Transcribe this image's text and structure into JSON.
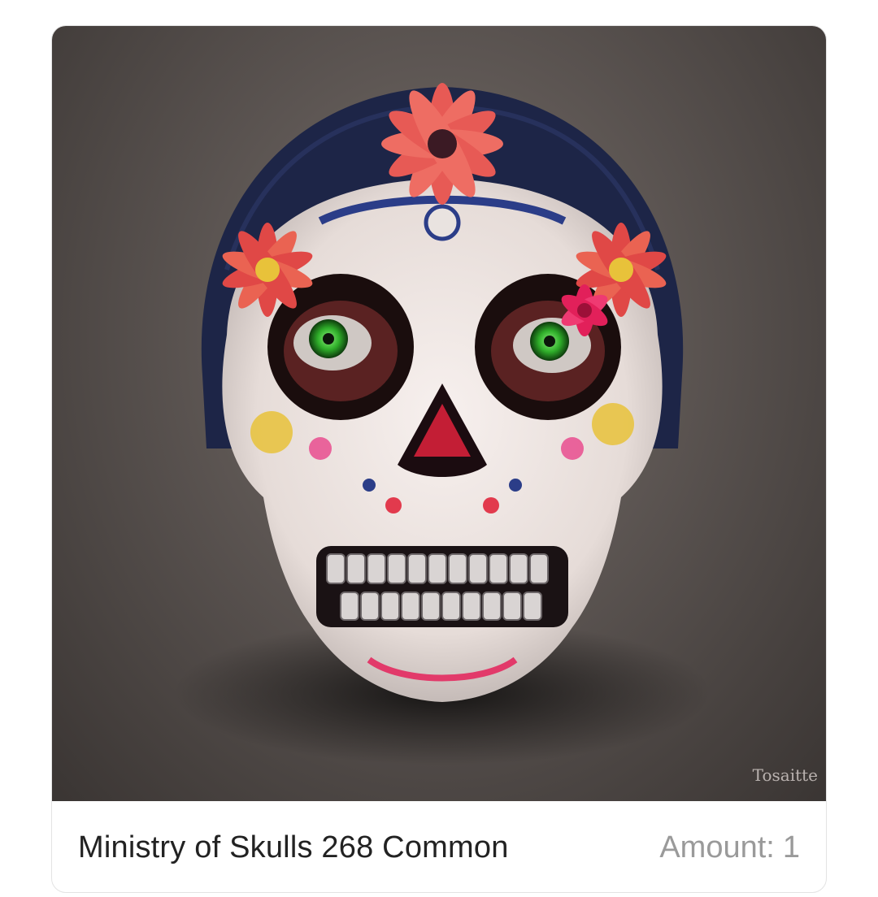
{
  "nft_card": {
    "title": "Ministry of Skulls 268 Common",
    "amount_label": "Amount:",
    "amount_value": "1",
    "artwork": {
      "signature": "Tosaitte",
      "colors": {
        "background": "#5e5754",
        "hood": "#1d2547",
        "skull": "#efe7e3",
        "flower": "#e3484c",
        "eye": "#3fd13f"
      }
    }
  }
}
